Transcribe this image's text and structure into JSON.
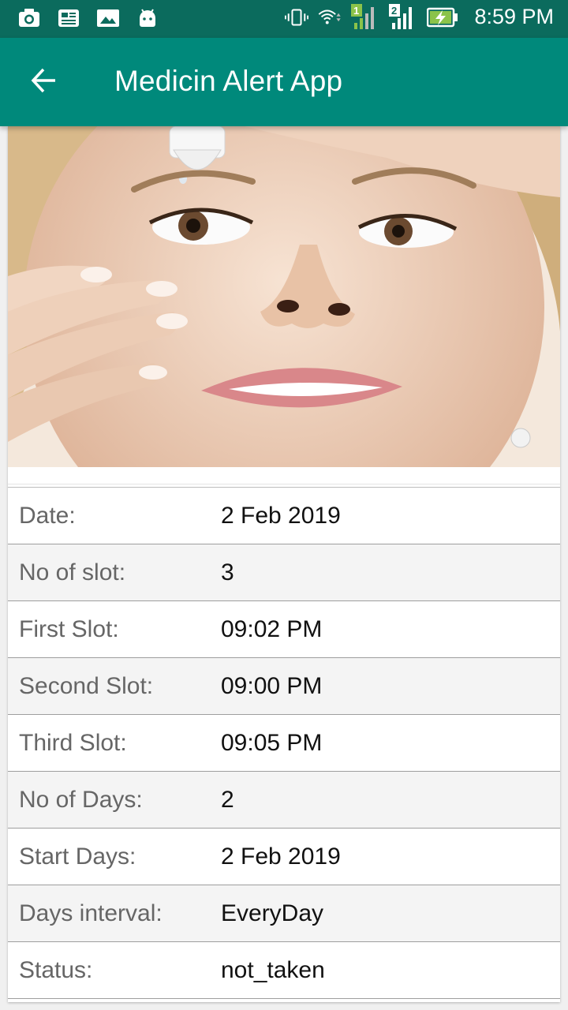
{
  "status_bar": {
    "time": "8:59 PM",
    "left_icons": [
      "camera-icon",
      "news-icon",
      "image-icon",
      "android-icon"
    ],
    "right_icons": [
      "vibrate-icon",
      "wifi-icon",
      "signal-sim1-icon",
      "signal-sim2-icon",
      "battery-charging-icon"
    ],
    "sim1_label": "1",
    "sim2_label": "2"
  },
  "app_bar": {
    "title": "Medicin Alert App",
    "back_icon": "arrow-back-icon"
  },
  "colors": {
    "status_bar": "#0b6b5d",
    "app_bar": "#00897b",
    "row_alt": "#f4f4f4"
  },
  "medicine_image": {
    "description_icon": "eye-drops-photo"
  },
  "details": [
    {
      "label": "Date:",
      "value": "2 Feb 2019"
    },
    {
      "label": "No of slot:",
      "value": "3"
    },
    {
      "label": "First Slot:",
      "value": "09:02 PM"
    },
    {
      "label": "Second Slot:",
      "value": "09:00 PM"
    },
    {
      "label": "Third Slot:",
      "value": "09:05 PM"
    },
    {
      "label": "No of Days:",
      "value": "2"
    },
    {
      "label": "Start Days:",
      "value": "2 Feb 2019"
    },
    {
      "label": "Days interval:",
      "value": "EveryDay"
    },
    {
      "label": "Status:",
      "value": "not_taken"
    }
  ]
}
